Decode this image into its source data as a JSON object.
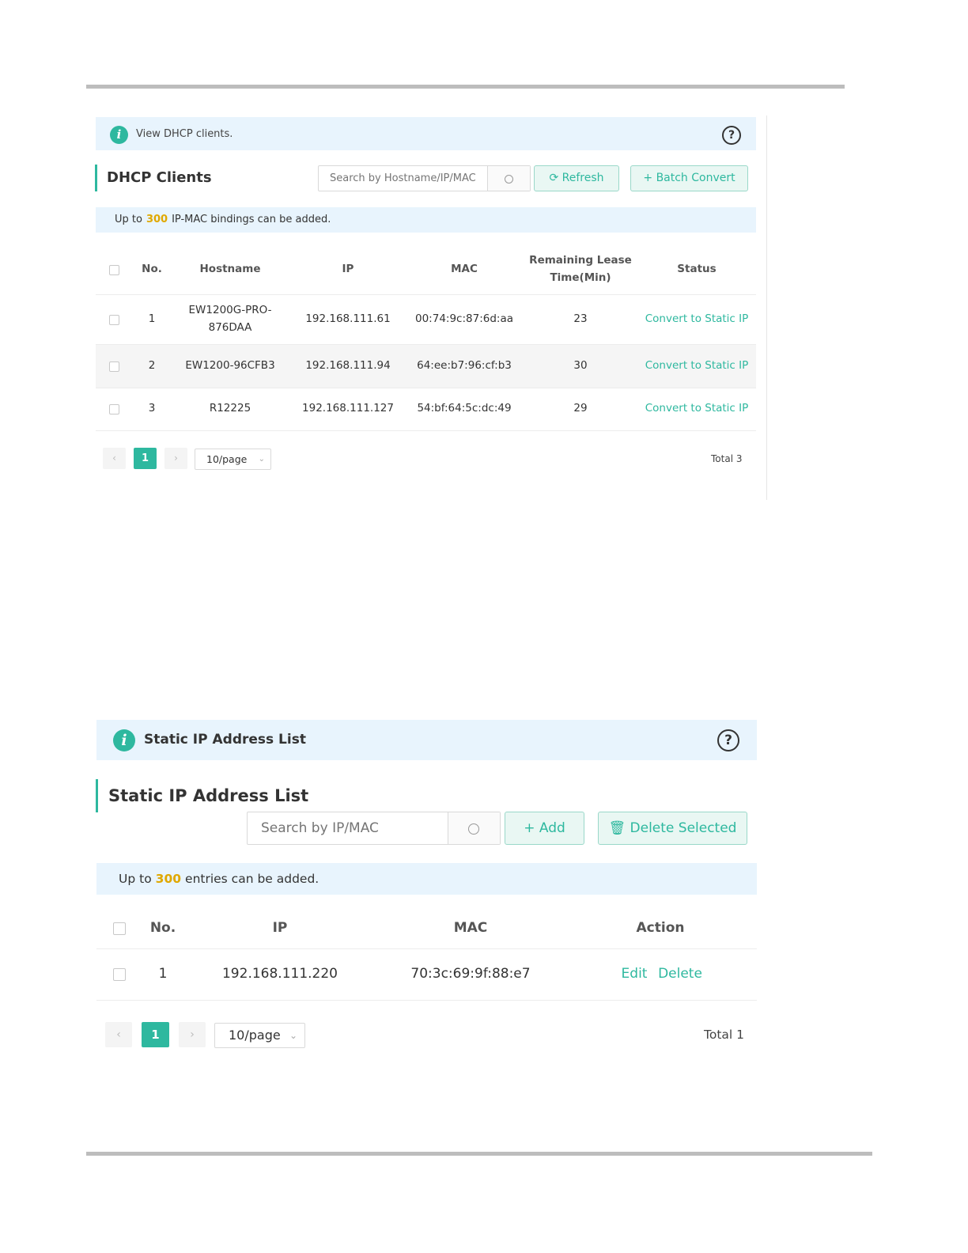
{
  "dhcp": {
    "info_text": "View DHCP clients.",
    "title": "DHCP Clients",
    "search_placeholder": "Search by Hostname/IP/MAC",
    "refresh_label": "Refresh",
    "batch_convert_label": "Batch Convert",
    "notice_prefix": "Up to",
    "notice_count": "300",
    "notice_suffix": "IP-MAC bindings can be added.",
    "columns": {
      "no": "No.",
      "hostname": "Hostname",
      "ip": "IP",
      "mac": "MAC",
      "lease_line1": "Remaining Lease",
      "lease_line2": "Time(Min)",
      "status": "Status"
    },
    "rows": [
      {
        "no": "1",
        "hostname_line1": "EW1200G-PRO-",
        "hostname_line2": "876DAA",
        "ip": "192.168.111.61",
        "mac": "00:74:9c:87:6d:aa",
        "lease": "23",
        "action": "Convert to Static IP"
      },
      {
        "no": "2",
        "hostname": "EW1200-96CFB3",
        "ip": "192.168.111.94",
        "mac": "64:ee:b7:96:cf:b3",
        "lease": "30",
        "action": "Convert to Static IP"
      },
      {
        "no": "3",
        "hostname": "R12225",
        "ip": "192.168.111.127",
        "mac": "54:bf:64:5c:dc:49",
        "lease": "29",
        "action": "Convert to Static IP"
      }
    ],
    "pagination": {
      "prev": "‹",
      "page": "1",
      "next": "›",
      "page_size": "10/page",
      "total": "Total 3"
    }
  },
  "static": {
    "info_text": "Static IP Address List",
    "title": "Static IP Address List",
    "search_placeholder": "Search by IP/MAC",
    "add_label": "Add",
    "delete_label": "Delete Selected",
    "notice_prefix": "Up to",
    "notice_count": "300",
    "notice_suffix": "entries can be added.",
    "columns": {
      "no": "No.",
      "ip": "IP",
      "mac": "MAC",
      "action": "Action"
    },
    "rows": [
      {
        "no": "1",
        "ip": "192.168.111.220",
        "mac": "70:3c:69:9f:88:e7",
        "edit": "Edit",
        "delete": "Delete"
      }
    ],
    "pagination": {
      "prev": "‹",
      "page": "1",
      "next": "›",
      "page_size": "10/page",
      "total": "Total 1"
    }
  },
  "icons": {
    "info": "info-icon",
    "help": "question-circle-icon",
    "search": "search-icon",
    "refresh": "refresh-icon",
    "plus": "plus-icon",
    "trash": "trash-icon",
    "chevron_down": "chevron-down-icon"
  },
  "colors": {
    "accent": "#2eb89f",
    "highlight": "#e0a800",
    "info_bg": "#e8f4fd"
  }
}
